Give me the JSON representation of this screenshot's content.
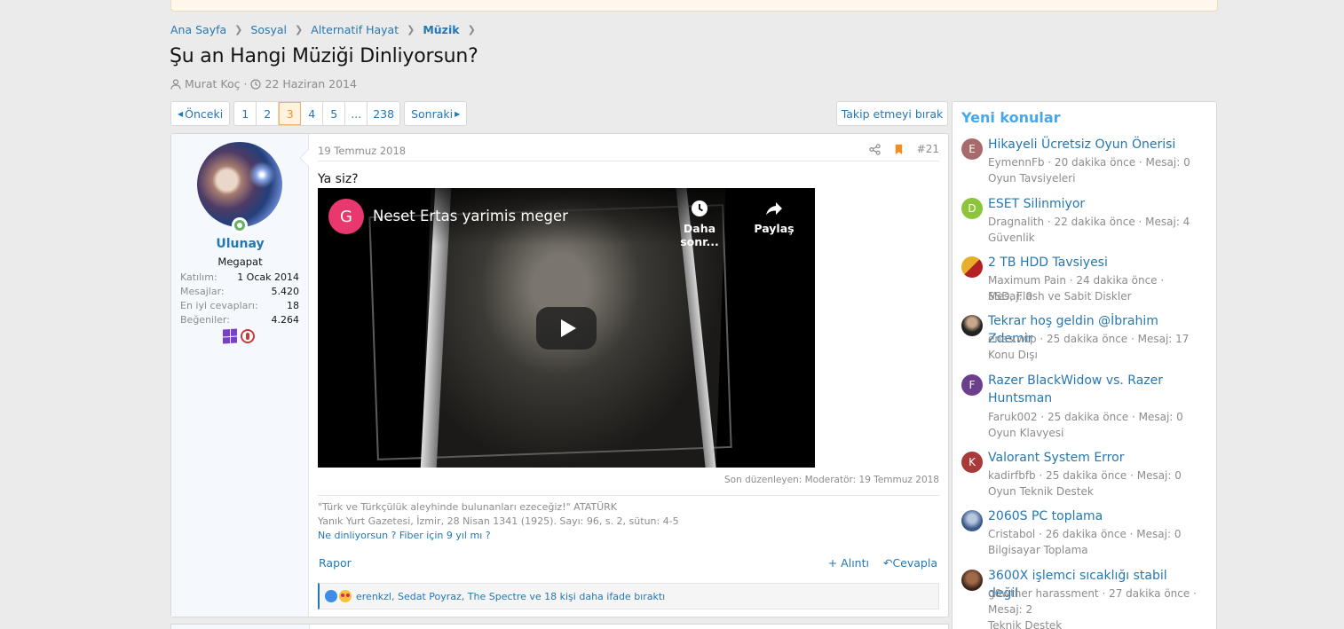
{
  "breadcrumb": [
    {
      "label": "Ana Sayfa"
    },
    {
      "label": "Sosyal"
    },
    {
      "label": "Alternatif Hayat"
    },
    {
      "label": "Müzik"
    }
  ],
  "thread": {
    "title": "Şu an Hangi Müziği Dinliyorsun?",
    "author": "Murat Koç",
    "date": "22 Haziran 2014"
  },
  "pagination": {
    "prev": "Önceki",
    "next": "Sonraki",
    "pages": [
      "1",
      "2",
      "3",
      "4",
      "5",
      "...",
      "238"
    ],
    "current": "3"
  },
  "watch_button": "Takip etmeyi bırak",
  "post": {
    "user": {
      "name": "Ulunay",
      "title": "Megapat",
      "stats": [
        {
          "k": "Katılım:",
          "v": "1 Ocak 2014"
        },
        {
          "k": "Mesajlar:",
          "v": "5.420"
        },
        {
          "k": "En iyi cevapları:",
          "v": "18"
        },
        {
          "k": "Beğeniler:",
          "v": "4.264"
        }
      ]
    },
    "date": "19 Temmuz 2018",
    "number": "#21",
    "text": "Ya siz?",
    "video": {
      "channel_initial": "G",
      "title": "Neset Ertas yarimis meger",
      "watch_later": "Daha sonr...",
      "share": "Paylaş"
    },
    "last_edit": "Son düzenleyen: Moderatör: 19 Temmuz 2018",
    "signature": {
      "line1": "\"Türk ve Türkçülük aleyhinde bulunanları ezeceğiz!\" ATATÜRK",
      "line2": "Yanık Yurt Gazetesi, İzmir, 28 Nisan 1341 (1925). Sayı: 96, s. 2, sütun: 4-5",
      "link": "Ne dinliyorsun ? Fiber için 9 yıl mı ?"
    },
    "report": "Rapor",
    "quote": "+ Alıntı",
    "reply": "Cevapla",
    "reactions_text": "erenkzl, Sedat Poyraz, The Spectre ve 18 kişi daha ifade bıraktı"
  },
  "sidebar": {
    "title": "Yeni konular",
    "topics": [
      {
        "initial": "E",
        "color": "#a86b6b",
        "title": "Hikayeli Ücretsiz Oyun Önerisi",
        "meta": "EymennFb · 20 dakika önce · Mesaj: 0",
        "forum": "Oyun Tavsiyeleri"
      },
      {
        "initial": "D",
        "color": "#8cc43c",
        "title": "ESET Silinmiyor",
        "meta": "Dragnalith · 22 dakika önce · Mesaj: 4",
        "forum": "Güvenlik"
      },
      {
        "initial": "",
        "color": "#d9a02a",
        "title": "2 TB HDD Tavsiyesi",
        "meta": "Maximum Pain · 24 dakika önce · Mesaj: 0",
        "forum": "SSD, Flash ve Sabit Diskler"
      },
      {
        "initial": "",
        "color": "#333333",
        "title": "Tekrar hoş geldin @İbrahim Zdemir",
        "meta": "enes.wtp · 25 dakika önce · Mesaj: 17",
        "forum": "Konu Dışı"
      },
      {
        "initial": "F",
        "color": "#6b3f8c",
        "title": "Razer BlackWidow vs. Razer Huntsman",
        "meta": "Faruk002 · 25 dakika önce · Mesaj: 0",
        "forum": "Oyun Klavyesi"
      },
      {
        "initial": "K",
        "color": "#a83a3a",
        "title": "Valorant System Error",
        "meta": "kadirfbfb · 25 dakika önce · Mesaj: 0",
        "forum": "Oyun Teknik Destek"
      },
      {
        "initial": "",
        "color": "#4a6a9a",
        "title": "2060S PC toplama",
        "meta": "Cristabol · 26 dakika önce · Mesaj: 0",
        "forum": "Bilgisayar Toplama"
      },
      {
        "initial": "",
        "color": "#5a3a2a",
        "title": "3600X işlemci sıcaklığı stabil değil",
        "meta": "g0wther harassment · 27 dakika önce · Mesaj: 2",
        "forum": "Teknik Destek"
      }
    ]
  }
}
